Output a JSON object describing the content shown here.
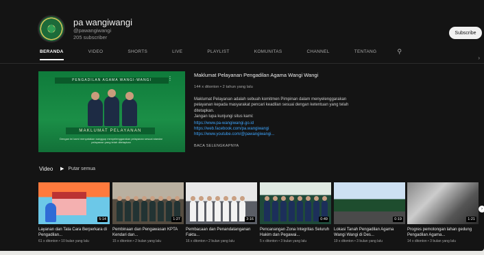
{
  "channel": {
    "name": "pa wangiwangi",
    "handle": "@pawangiwangi",
    "subscribers": "205 subscriber",
    "subscribe_label": "Subscribe"
  },
  "tabs": [
    {
      "label": "BERANDA",
      "active": true
    },
    {
      "label": "VIDEO"
    },
    {
      "label": "SHORTS"
    },
    {
      "label": "LIVE"
    },
    {
      "label": "PLAYLIST"
    },
    {
      "label": "KOMUNITAS"
    },
    {
      "label": "CHANNEL"
    },
    {
      "label": "TENTANG"
    }
  ],
  "icons": {
    "search": "search-icon",
    "next": "chevron-right-icon"
  },
  "featured": {
    "thumb_header": "PENGADILAN AGAMA WANGI-WANGI",
    "thumb_banner": "MAKLUMAT PELAYANAN",
    "thumb_text": "Dengan ini kami menyatakan sanggup menyelenggarakan pelayanan sesuai standar pelayanan yang telah ditetapkan",
    "title": "Maklumat Pelayanan Pengadilan Agama Wangi Wangi",
    "meta": "144 x ditonton • 2 tahun yang lalu",
    "description": "Maklumat Pelayanan adalah sebuah komitmen Pimpinan dalam menyelenggarakan pelayanan kepada masyarakat pencari keadilan sesuai dengan ketentuan yang telah ditetapkan.",
    "visit_line": "Jangan lupa kunjungi situs kami:",
    "links": [
      "https://www.pa-wangiwangi.go.id",
      "https://web.facebook.com/pa.wangiwangi",
      "https://www.youtube.com/@pawangiwangi..."
    ],
    "read_more": "BACA SELENGKAPNYA"
  },
  "section": {
    "title": "Video",
    "play_all": "Putar semua"
  },
  "videos": [
    {
      "title": "Layanan dan Tata Cara Berperkara di Pengadilan...",
      "meta": "61 x ditonton • 10 bulan yang lalu",
      "duration": "5:14"
    },
    {
      "title": "Pembinaan dan Pengawasan KPTA Kendari dan...",
      "meta": "15 x ditonton • 2 bulan yang lalu",
      "duration": "1:27"
    },
    {
      "title": "Pembacaan dan Penandatanganan Fakta...",
      "meta": "16 x ditonton • 2 bulan yang lalu",
      "duration": "3:16"
    },
    {
      "title": "Pencanangan Zona Integritas Seluruh Hakim dan Pegawai...",
      "meta": "5 x ditonton • 3 bulan yang lalu",
      "duration": "0:49"
    },
    {
      "title": "Lokasi Tanah Pengadilan Agama Wangi Wangi di Des...",
      "meta": "19 x ditonton • 3 bulan yang lalu",
      "duration": "0:19"
    },
    {
      "title": "Progres pemotongan lahan gedung Pengadilan Agama...",
      "meta": "14 x ditonton • 3 bulan yang lalu",
      "duration": "1:21"
    }
  ]
}
